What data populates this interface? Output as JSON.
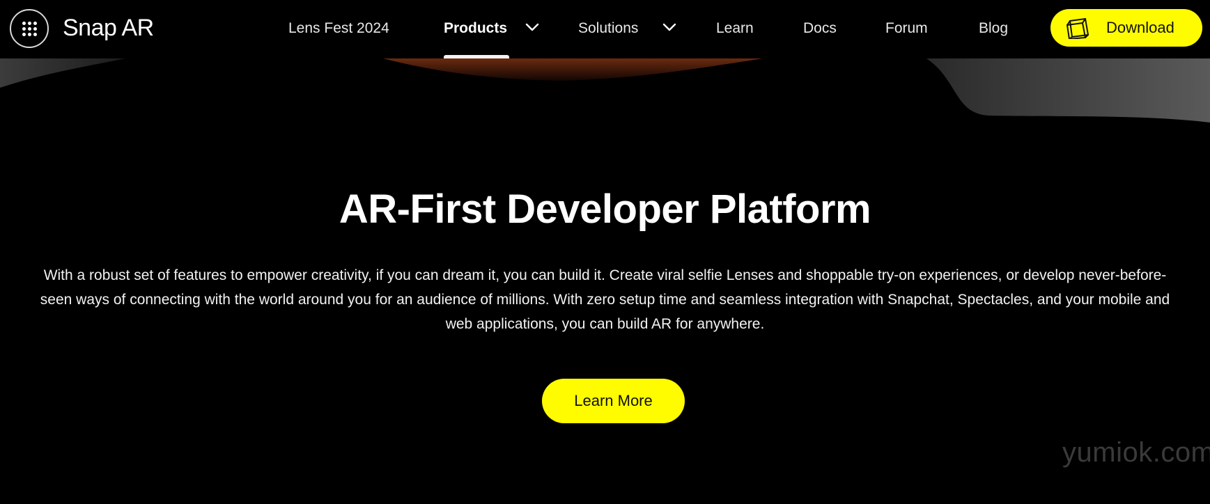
{
  "brand": {
    "name": "Snap AR"
  },
  "nav": {
    "items": [
      {
        "label": "Lens Fest 2024"
      },
      {
        "label": "Products"
      },
      {
        "label": "Solutions"
      },
      {
        "label": "Learn"
      },
      {
        "label": "Docs"
      },
      {
        "label": "Forum"
      },
      {
        "label": "Blog"
      }
    ],
    "download_label": "Download",
    "active_item": "Products"
  },
  "hero": {
    "title": "AR-First Developer Platform",
    "description": "With a robust set of features to empower creativity, if you can dream it, you can build it. Create viral selfie Lenses and shoppable try-on experiences, or develop never-before-seen ways of connecting with the world around you for an audience of millions. With zero setup time and seamless integration with Snapchat, Spectacles, and your mobile and web applications, you can build AR for anywhere.",
    "cta_label": "Learn More"
  },
  "watermark": {
    "text": "yumiok.com"
  },
  "colors": {
    "accent": "#FFFC00",
    "background": "#000000",
    "text": "#FFFFFF"
  },
  "icons": {
    "apps": "grid-dots-icon",
    "dropdown": "chevron-down-icon",
    "download": "lens-studio-icon"
  }
}
